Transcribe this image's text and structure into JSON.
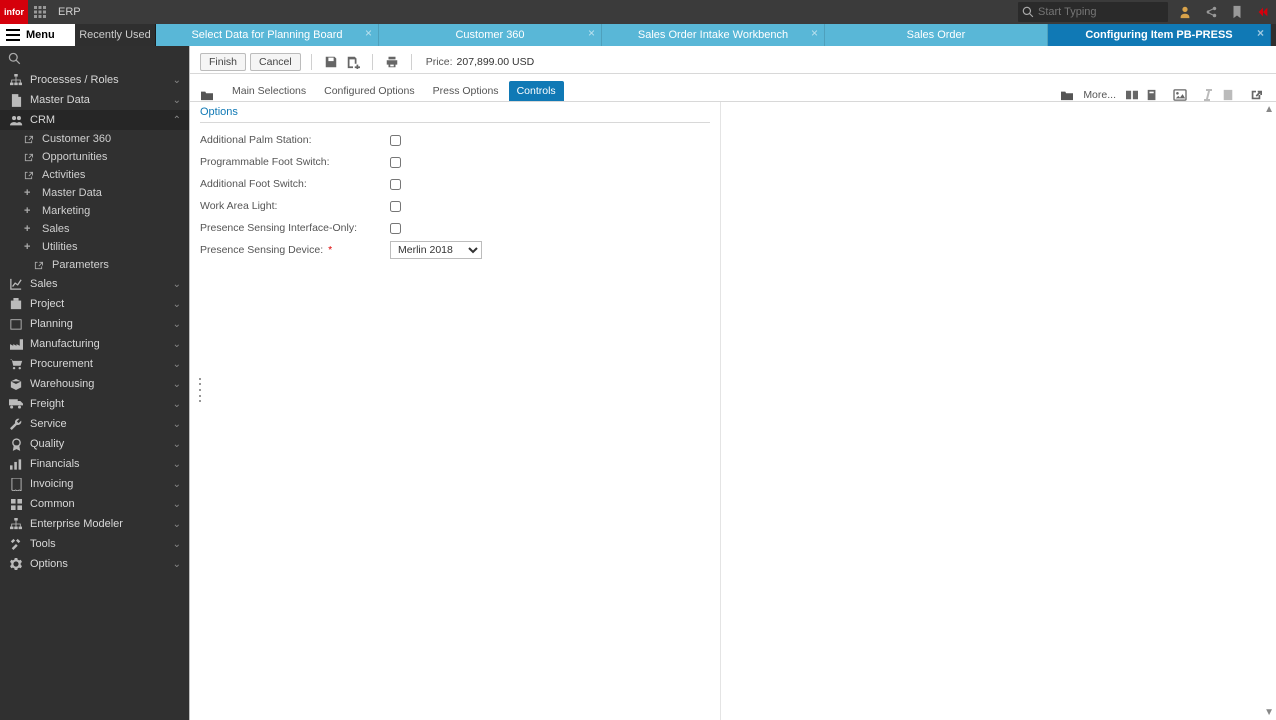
{
  "top": {
    "brand": "infor",
    "app": "ERP",
    "searchPlaceholder": "Start Typing"
  },
  "tabs": {
    "menuLabel": "Menu",
    "recentLabel": "Recently Used",
    "items": [
      {
        "label": "Select Data for Planning Board"
      },
      {
        "label": "Customer 360"
      },
      {
        "label": "Sales Order Intake Workbench"
      },
      {
        "label": "Sales Order"
      },
      {
        "label": "Configuring Item PB-PRESS",
        "active": true
      }
    ]
  },
  "nav": {
    "groups": [
      {
        "icon": "sitemap",
        "label": "Processes / Roles"
      },
      {
        "icon": "doc",
        "label": "Master Data"
      },
      {
        "icon": "users",
        "label": "CRM",
        "expanded": true,
        "children": [
          {
            "icon": "ext",
            "label": "Customer 360"
          },
          {
            "icon": "ext",
            "label": "Opportunities"
          },
          {
            "icon": "ext",
            "label": "Activities"
          },
          {
            "icon": "plus",
            "label": "Master Data"
          },
          {
            "icon": "plus",
            "label": "Marketing"
          },
          {
            "icon": "plus",
            "label": "Sales"
          },
          {
            "icon": "plus",
            "label": "Utilities",
            "children": [
              {
                "icon": "ext",
                "label": "Parameters"
              }
            ]
          }
        ]
      },
      {
        "icon": "chart",
        "label": "Sales"
      },
      {
        "icon": "proj",
        "label": "Project"
      },
      {
        "icon": "cal",
        "label": "Planning"
      },
      {
        "icon": "factory",
        "label": "Manufacturing"
      },
      {
        "icon": "cart",
        "label": "Procurement"
      },
      {
        "icon": "box",
        "label": "Warehousing"
      },
      {
        "icon": "truck",
        "label": "Freight"
      },
      {
        "icon": "wrench",
        "label": "Service"
      },
      {
        "icon": "badge",
        "label": "Quality"
      },
      {
        "icon": "bars",
        "label": "Financials"
      },
      {
        "icon": "invoice",
        "label": "Invoicing"
      },
      {
        "icon": "grid",
        "label": "Common"
      },
      {
        "icon": "sitemap",
        "label": "Enterprise Modeler"
      },
      {
        "icon": "tools",
        "label": "Tools"
      },
      {
        "icon": "gear",
        "label": "Options"
      }
    ]
  },
  "toolbar": {
    "finish": "Finish",
    "cancel": "Cancel",
    "priceLabel": "Price:",
    "priceValue": "207,899.00 USD"
  },
  "subtabs": {
    "items": [
      {
        "label": "Main Selections"
      },
      {
        "label": "Configured Options"
      },
      {
        "label": "Press Options"
      },
      {
        "label": "Controls",
        "active": true
      }
    ],
    "more": "More..."
  },
  "form": {
    "section": "Options",
    "rows": [
      {
        "label": "Additional Palm Station:",
        "type": "check"
      },
      {
        "label": "Programmable Foot Switch:",
        "type": "check"
      },
      {
        "label": "Additional Foot Switch:",
        "type": "check"
      },
      {
        "label": "Work Area Light:",
        "type": "check"
      },
      {
        "label": "Presence Sensing Interface-Only:",
        "type": "check"
      },
      {
        "label": "Presence Sensing Device:",
        "type": "select",
        "required": true,
        "value": "Merlin 2018"
      }
    ]
  }
}
